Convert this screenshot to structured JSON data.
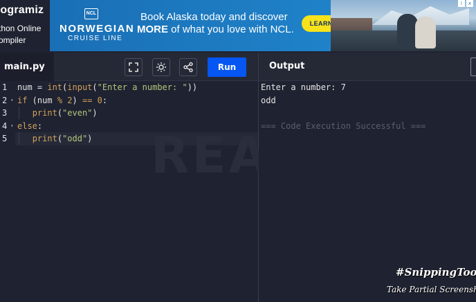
{
  "brand": {
    "name": "rogramiz",
    "sub1": "thon Online",
    "sub2": "ompiler"
  },
  "ad": {
    "badge": "NCL",
    "title": "NORWEGIAN",
    "subtitle": "CRUISE LINE",
    "line1": "Book Alaska today and discover",
    "line2_bold": "MORE",
    "line2_rest": " of what you love with NCL.",
    "cta": "LEARN MORE",
    "info_icon": "i",
    "close_icon": "x"
  },
  "editor": {
    "tab": "main.py",
    "run_label": "Run",
    "watermark": "READY",
    "icons": [
      "fullscreen-icon",
      "theme-sun-icon",
      "share-icon"
    ],
    "line_numbers": [
      "1",
      "2",
      "3",
      "4",
      "5"
    ],
    "lines": [
      [
        {
          "t": "num = ",
          "c": "def"
        },
        {
          "t": "int",
          "c": "fn"
        },
        {
          "t": "(",
          "c": "def"
        },
        {
          "t": "input",
          "c": "fn"
        },
        {
          "t": "(",
          "c": "def"
        },
        {
          "t": "\"Enter a number: \"",
          "c": "str"
        },
        {
          "t": "))",
          "c": "def"
        }
      ],
      [
        {
          "t": "if",
          "c": "kw"
        },
        {
          "t": " (num ",
          "c": "def"
        },
        {
          "t": "%",
          "c": "op"
        },
        {
          "t": " ",
          "c": "def"
        },
        {
          "t": "2",
          "c": "num"
        },
        {
          "t": ") ",
          "c": "def"
        },
        {
          "t": "==",
          "c": "op"
        },
        {
          "t": " ",
          "c": "def"
        },
        {
          "t": "0",
          "c": "num"
        },
        {
          "t": ":",
          "c": "def"
        }
      ],
      [
        {
          "t": "   ",
          "c": "def"
        },
        {
          "t": "print",
          "c": "fn"
        },
        {
          "t": "(",
          "c": "def"
        },
        {
          "t": "\"even\"",
          "c": "str"
        },
        {
          "t": ")",
          "c": "def"
        }
      ],
      [
        {
          "t": "else",
          "c": "kw"
        },
        {
          "t": ":",
          "c": "def"
        }
      ],
      [
        {
          "t": "   ",
          "c": "def"
        },
        {
          "t": "print",
          "c": "fn"
        },
        {
          "t": "(",
          "c": "def"
        },
        {
          "t": "\"odd\"",
          "c": "str"
        },
        {
          "t": ")",
          "c": "def"
        }
      ]
    ]
  },
  "output": {
    "title": "Output",
    "lines": [
      "Enter a number: 7",
      "odd",
      "",
      "=== Code Execution Successful ==="
    ]
  },
  "overlay": {
    "hashtag": "#SnippingTool",
    "caption": "Take Partial Screenshot"
  },
  "colors": {
    "background": "#1f2230",
    "run_button": "#0556f3",
    "cta_button": "#f7e21b",
    "ad_blue": "#1e7cc3"
  }
}
